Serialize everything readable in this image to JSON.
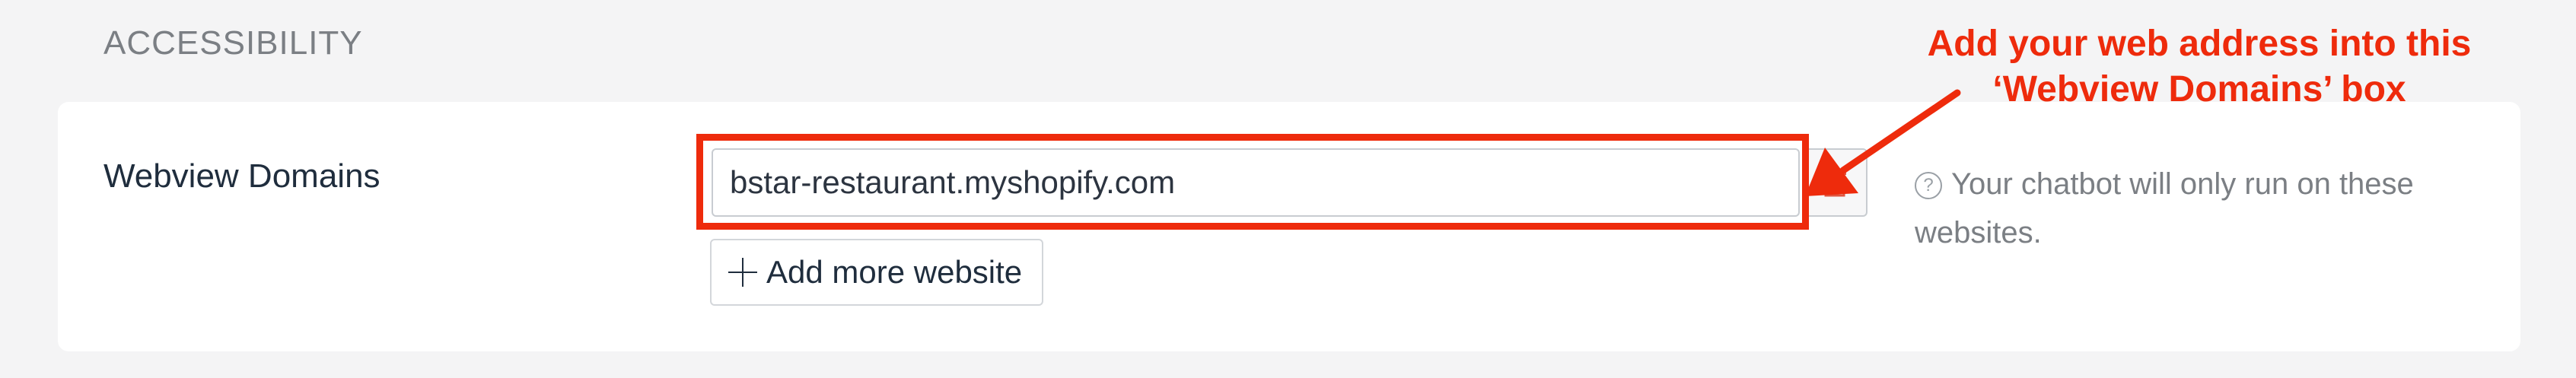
{
  "section": {
    "heading": "ACCESSIBILITY"
  },
  "field": {
    "label": "Webview Domains",
    "value": "bstar-restaurant.myshopify.com",
    "delete_icon": "trash-icon"
  },
  "add_more": {
    "label": "Add more website",
    "icon": "plus-icon"
  },
  "help": {
    "icon": "question-circle-icon",
    "text": "Your chatbot will only run on these websites."
  },
  "annotation": {
    "line1": "Add your web address into this",
    "line2": "‘Webview Domains’ box",
    "color": "#ee2b0c"
  }
}
